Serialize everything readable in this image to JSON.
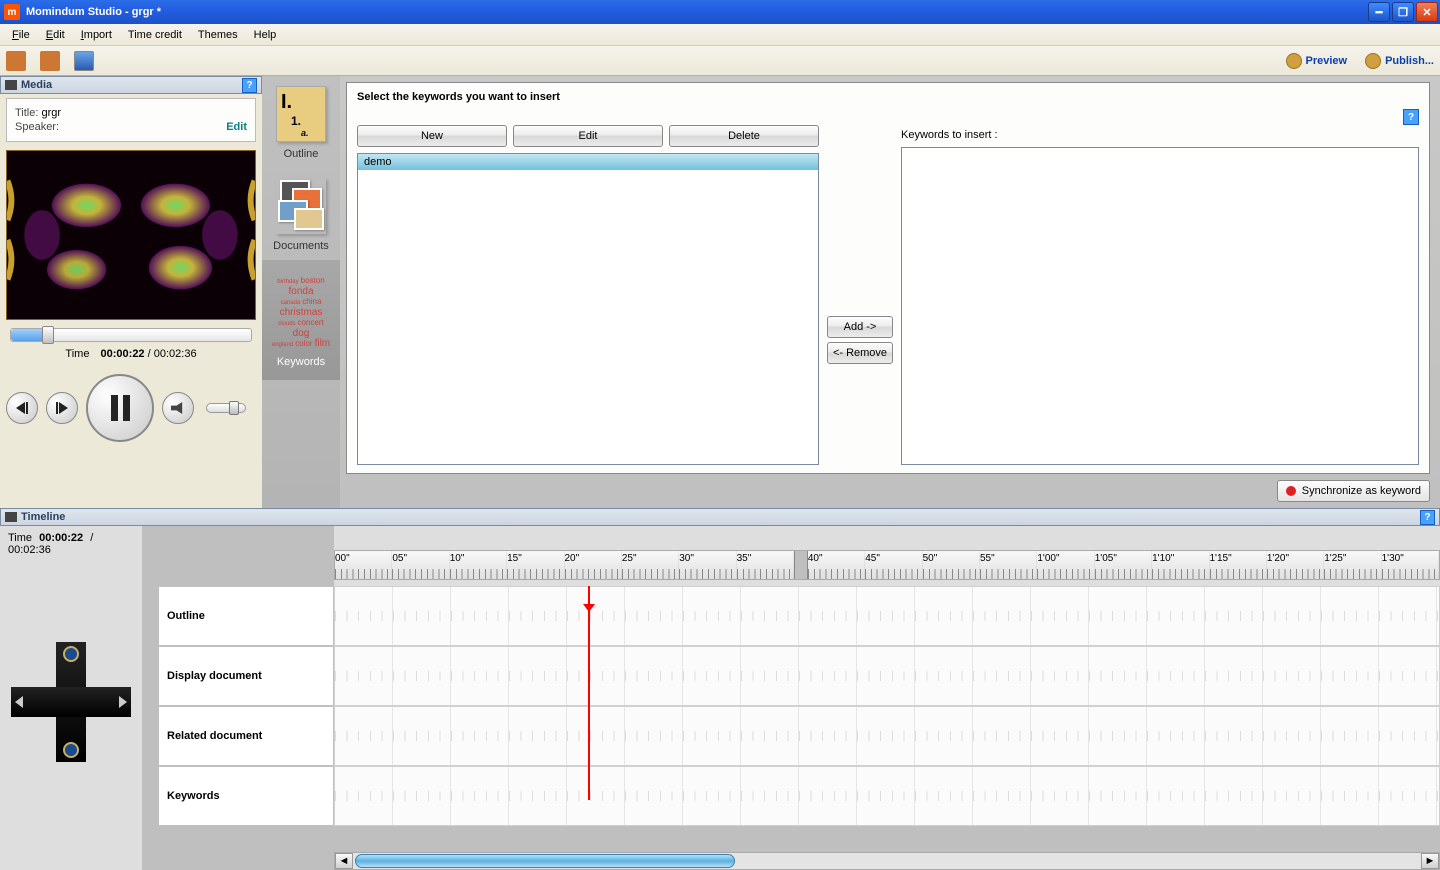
{
  "window": {
    "title": "Momindum Studio - grgr *"
  },
  "menu": {
    "file": "File",
    "edit": "Edit",
    "import": "Import",
    "time_credit": "Time credit",
    "themes": "Themes",
    "help": "Help"
  },
  "toolbar": {
    "preview": "Preview",
    "publish": "Publish..."
  },
  "media": {
    "panel_title": "Media",
    "title_label": "Title:",
    "title_value": "grgr",
    "speaker_label": "Speaker:",
    "speaker_value": "",
    "edit": "Edit",
    "time_label": "Time",
    "time_current": "00:00:22",
    "time_sep": "/",
    "time_total": "00:02:36"
  },
  "tabs": {
    "outline": "Outline",
    "documents": "Documents",
    "keywords": "Keywords"
  },
  "keywords_panel": {
    "title": "Select the keywords you want to insert",
    "new": "New",
    "edit": "Edit",
    "delete": "Delete",
    "add": "Add ->",
    "remove": "<- Remove",
    "to_insert": "Keywords to insert :",
    "sync": "Synchronize as keyword",
    "items": [
      "demo"
    ]
  },
  "cloud": [
    "birthday",
    "boston",
    "fonda",
    "canada",
    "china",
    "christmas",
    "clouds",
    "concert",
    "dog",
    "england",
    "color",
    "film"
  ],
  "timeline": {
    "panel_title": "Timeline",
    "time_label": "Time",
    "time_current": "00:00:22",
    "time_sep": "/",
    "time_total": "00:02:36",
    "tracks": [
      "Outline",
      "Display document",
      "Related document",
      "Keywords"
    ],
    "ticks": [
      "00\"",
      "05\"",
      "10\"",
      "15\"",
      "20\"",
      "25\"",
      "30\"",
      "35\"",
      "40\"",
      "45\"",
      "50\"",
      "55\"",
      "1'00\"",
      "1'05\"",
      "1'10\"",
      "1'15\"",
      "1'20\"",
      "1'25\"",
      "1'30\""
    ]
  }
}
